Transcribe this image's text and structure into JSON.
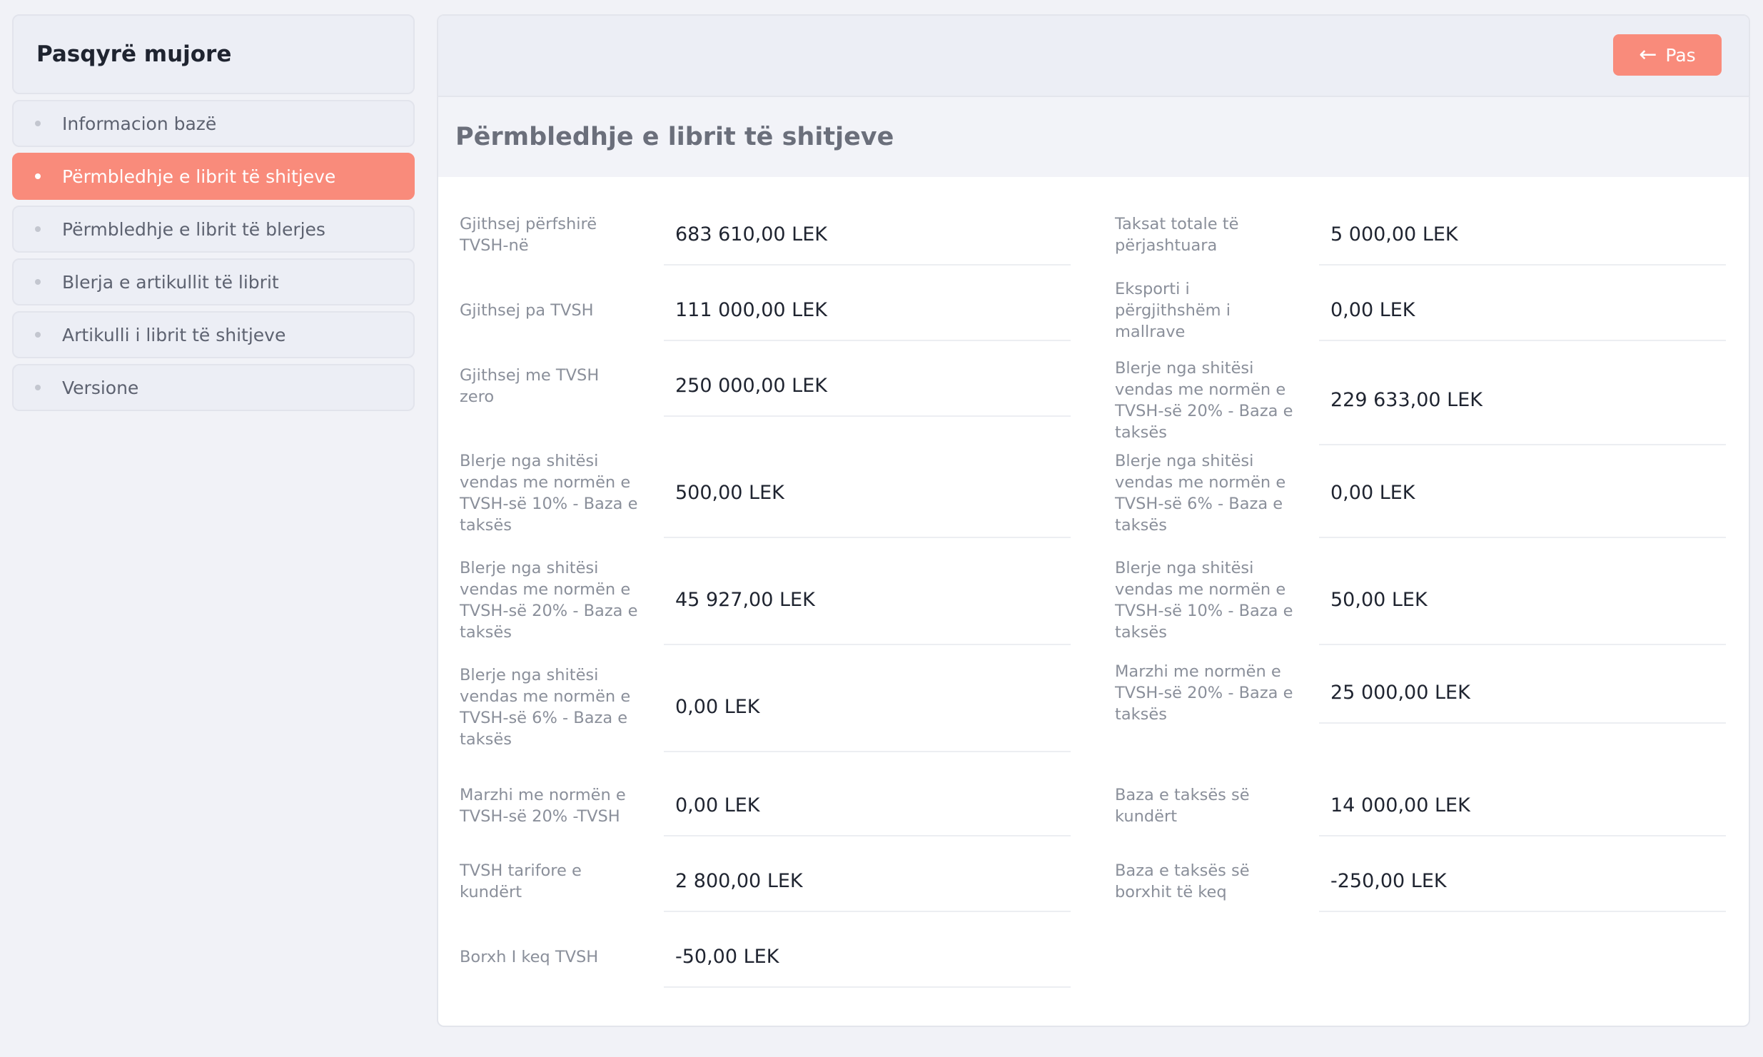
{
  "sidebar": {
    "title": "Pasqyrë mujore",
    "items": [
      {
        "label": "Informacion bazë",
        "active": false
      },
      {
        "label": "Përmbledhje e librit të shitjeve",
        "active": true
      },
      {
        "label": "Përmbledhje e librit të blerjes",
        "active": false
      },
      {
        "label": "Blerja e artikullit të librit",
        "active": false
      },
      {
        "label": "Artikulli i librit të shitjeve",
        "active": false
      },
      {
        "label": "Versione",
        "active": false
      }
    ]
  },
  "header": {
    "back_label": "Pas",
    "back_icon": "arrow-left-icon"
  },
  "section": {
    "title": "Përmbledhje e librit të shitjeve"
  },
  "fields_left": [
    {
      "label": "Gjithsej përfshirë TVSH-në",
      "value": "683 610,00 LEK"
    },
    {
      "label": "Gjithsej pa TVSH",
      "value": "111 000,00 LEK"
    },
    {
      "label": "Gjithsej me TVSH zero",
      "value": "250 000,00 LEK"
    },
    {
      "label": "Blerje nga shitësi vendas me normën e TVSH-së 10% - Baza e taksës",
      "value": "500,00 LEK"
    },
    {
      "label": "Blerje nga shitësi vendas me normën e TVSH-së 20% - Baza e taksës",
      "value": "45 927,00 LEK"
    },
    {
      "label": "Blerje nga shitësi vendas me normën e TVSH-së 6% - Baza e taksës",
      "value": "0,00 LEK"
    },
    {
      "label": "Marzhi me normën e TVSH-së 20% -TVSH",
      "value": "0,00 LEK"
    },
    {
      "label": "TVSH tarifore e kundërt",
      "value": "2 800,00 LEK"
    },
    {
      "label": "Borxh I keq TVSH",
      "value": "-50,00 LEK"
    }
  ],
  "fields_right": [
    {
      "label": "Taksat totale të përjashtuara",
      "value": "5 000,00 LEK"
    },
    {
      "label": "Eksporti i përgjithshëm i mallrave",
      "value": "0,00 LEK"
    },
    {
      "label": "Blerje nga shitësi vendas me normën e TVSH-së 20% - Baza e taksës",
      "value": "229 633,00 LEK"
    },
    {
      "label": "Blerje nga shitësi vendas me normën e TVSH-së 6% - Baza e taksës",
      "value": "0,00 LEK"
    },
    {
      "label": "Blerje nga shitësi vendas me normën e TVSH-së 10% - Baza e taksës",
      "value": "50,00 LEK"
    },
    {
      "label": "Marzhi me normën e TVSH-së 20% - Baza e taksës",
      "value": "25 000,00 LEK"
    },
    {
      "label": "Baza e taksës së kundërt",
      "value": "14 000,00 LEK"
    },
    {
      "label": "Baza e taksës së borxhit të keq",
      "value": "-250,00 LEK"
    }
  ],
  "colors": {
    "accent": "#f98b7b",
    "background": "#f1f2f7",
    "card": "#ffffff"
  }
}
